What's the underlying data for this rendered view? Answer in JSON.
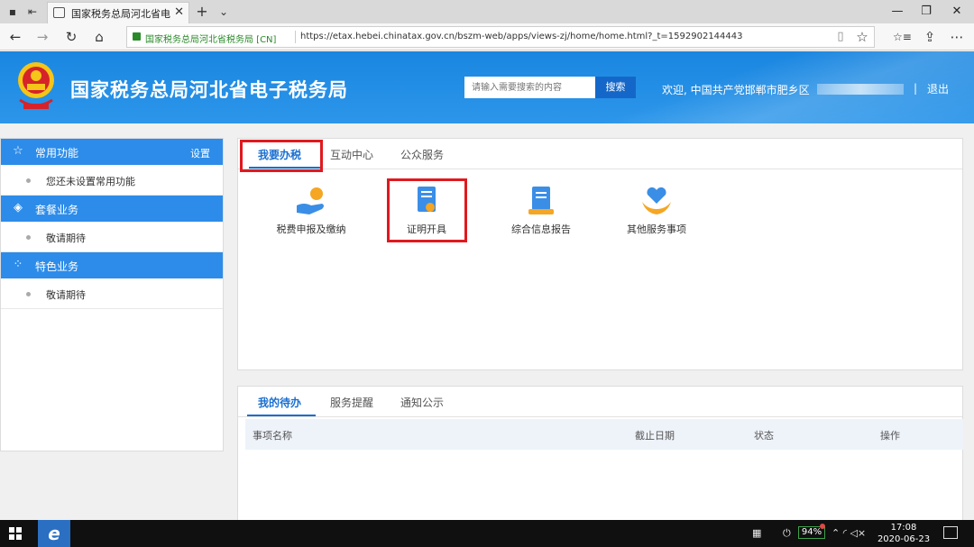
{
  "browser": {
    "tab_title": "国家税务总局河北省电子",
    "close_glyph": "✕",
    "new_tab_glyph": "+",
    "dropdown_glyph": "⌄",
    "site_identity": "国家税务总局河北省税务局 [CN]",
    "url": "https://etax.hebei.chinatax.gov.cn/bszm-web/apps/views-zj/home/home.html?_t=1592902144443",
    "icons": {
      "back": "←",
      "forward": "→",
      "refresh": "↻",
      "home": "⌂",
      "reading": "▯",
      "favorite": "☆",
      "hub": "☆≡",
      "share": "⇪",
      "more": "⋯",
      "min": "—",
      "max": "❐",
      "close": "✕"
    }
  },
  "header": {
    "title": "国家税务总局河北省电子税务局",
    "search_placeholder": "请输入需要搜索的内容",
    "search_button": "搜索",
    "welcome": "欢迎, 中国共产党邯郸市肥乡区",
    "separator": "|",
    "logout": "退出"
  },
  "sidebar": {
    "sections": [
      {
        "icon": "☆",
        "label": "常用功能",
        "action": "设置",
        "item": "您还未设置常用功能"
      },
      {
        "icon": "◈",
        "label": "套餐业务",
        "item": "敬请期待"
      },
      {
        "icon": "⁘",
        "label": "特色业务",
        "item": "敬请期待"
      }
    ]
  },
  "main_tabs": [
    "我要办税",
    "互动中心",
    "公众服务"
  ],
  "services": [
    {
      "label": "税费申报及缴纳",
      "icon": "hand-coin-icon"
    },
    {
      "label": "证明开具",
      "icon": "certificate-icon"
    },
    {
      "label": "综合信息报告",
      "icon": "report-book-icon"
    },
    {
      "label": "其他服务事项",
      "icon": "heart-hand-icon"
    }
  ],
  "todo_tabs": [
    "我的待办",
    "服务提醒",
    "通知公示"
  ],
  "todo_table": {
    "columns": [
      "事项名称",
      "截止日期",
      "状态",
      "操作"
    ]
  },
  "taskbar": {
    "battery": "94%",
    "time": "17:08",
    "date": "2020-06-23",
    "tray_icons": "⌃  ◜ ◁×",
    "keyboard_icon": "▦",
    "plug_icon": "⏻"
  },
  "colors": {
    "header_blue": "#1a86e0",
    "sidebar_blue": "#2d8ce9",
    "highlight_red": "#e0191e",
    "active_tab": "#1a6fd0"
  }
}
